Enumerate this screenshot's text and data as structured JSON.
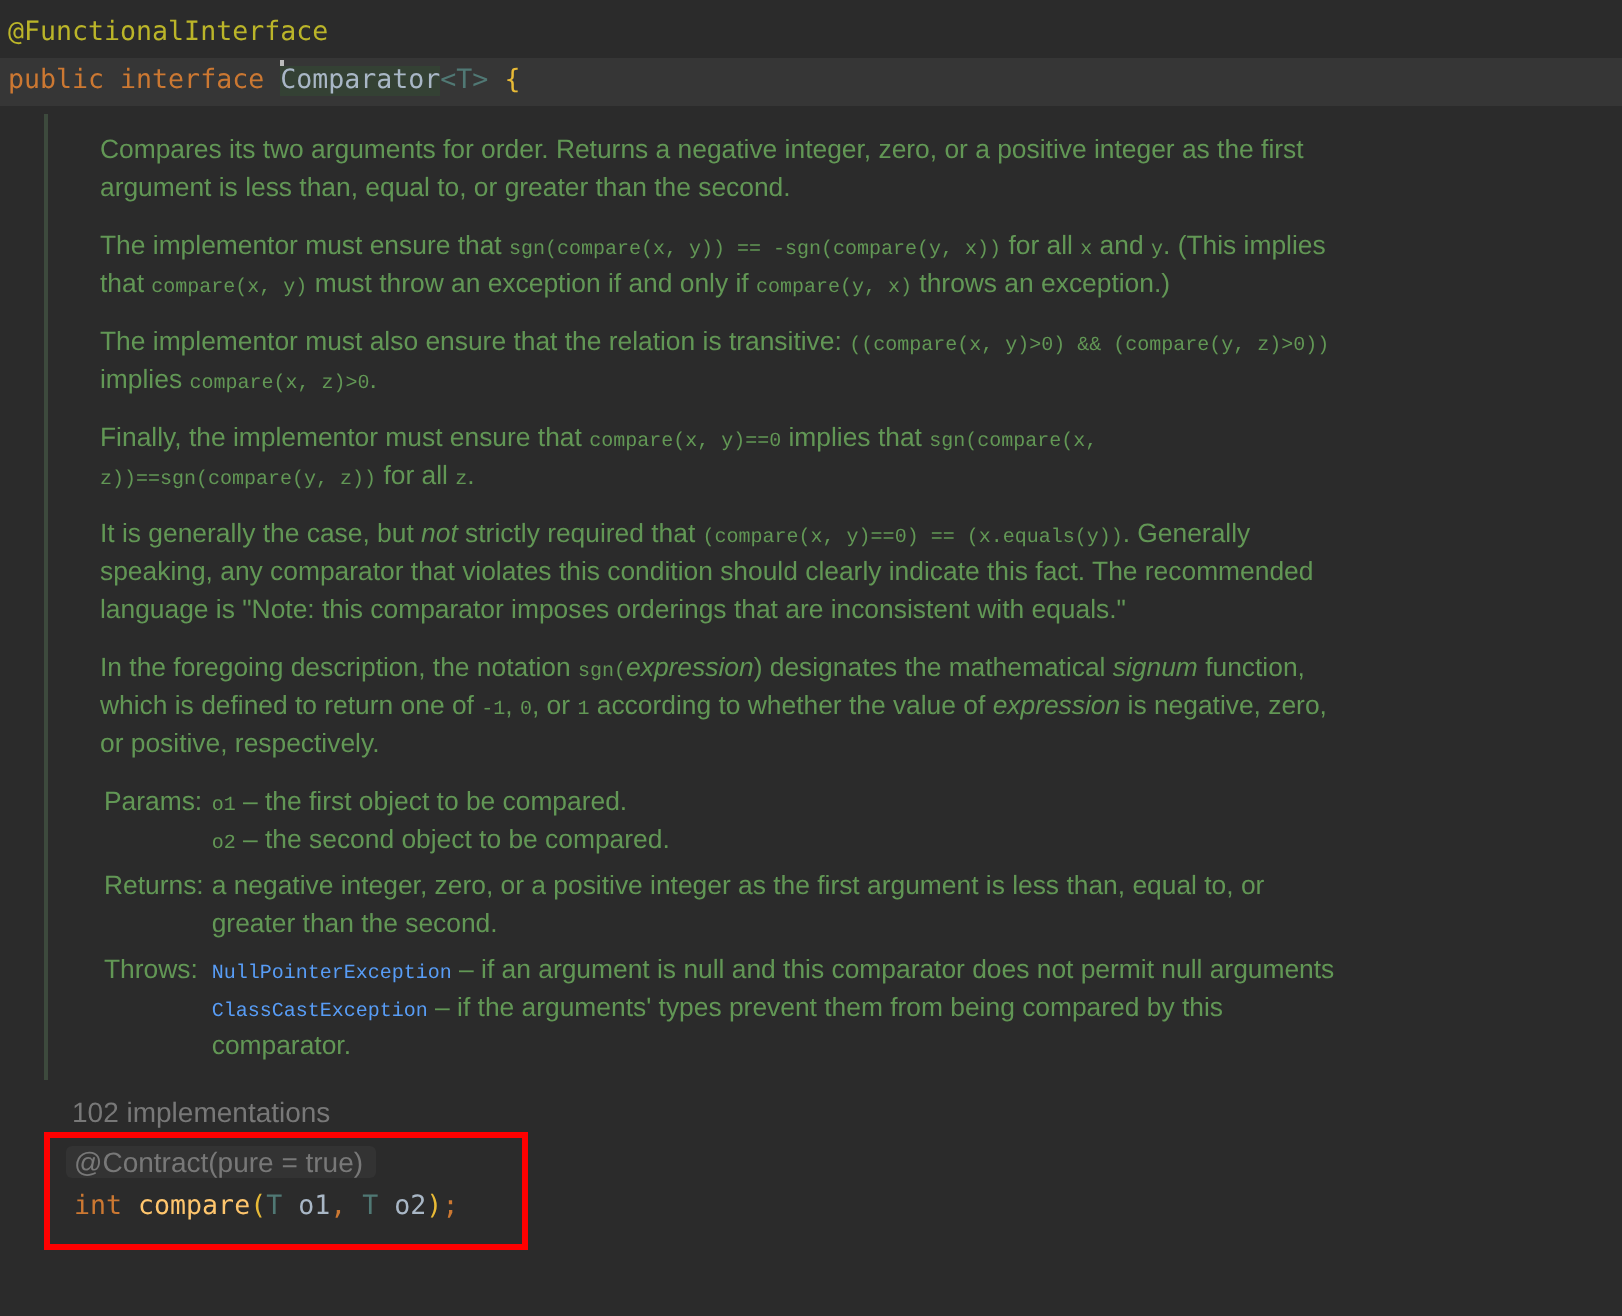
{
  "code_top": [
    {
      "tokens": [
        {
          "kind": "annotation",
          "text": "@FunctionalInterface"
        }
      ]
    },
    {
      "current": true,
      "tokens": [
        {
          "kind": "keyword",
          "text": "public interface "
        },
        {
          "kind": "class",
          "text": "Comparator"
        },
        {
          "kind": "typeparam",
          "text": "<T>"
        },
        {
          "kind": "brace",
          "text": " {"
        }
      ]
    }
  ],
  "doc": {
    "paragraphs": [
      [
        {
          "kind": "text",
          "text": "Compares its two arguments for order. Returns a negative integer, zero, or a positive integer as the first argument is less than, equal to, or greater than the second."
        }
      ],
      [
        {
          "kind": "text",
          "text": "The implementor must ensure that "
        },
        {
          "kind": "code",
          "text": "sgn(compare(x, y)) == -sgn(compare(y, x))"
        },
        {
          "kind": "text",
          "text": " for all "
        },
        {
          "kind": "code",
          "text": "x"
        },
        {
          "kind": "text",
          "text": " and "
        },
        {
          "kind": "code",
          "text": "y"
        },
        {
          "kind": "text",
          "text": ". (This implies that "
        },
        {
          "kind": "code",
          "text": "compare(x, y)"
        },
        {
          "kind": "text",
          "text": " must throw an exception if and only if "
        },
        {
          "kind": "code",
          "text": "compare(y, x)"
        },
        {
          "kind": "text",
          "text": " throws an exception.)"
        }
      ],
      [
        {
          "kind": "text",
          "text": "The implementor must also ensure that the relation is transitive: "
        },
        {
          "kind": "code",
          "text": "((compare(x, y)>0) && (compare(y, z)>0))"
        },
        {
          "kind": "text",
          "text": " implies "
        },
        {
          "kind": "code",
          "text": "compare(x, z)>0"
        },
        {
          "kind": "text",
          "text": "."
        }
      ],
      [
        {
          "kind": "text",
          "text": "Finally, the implementor must ensure that "
        },
        {
          "kind": "code",
          "text": "compare(x, y)==0"
        },
        {
          "kind": "text",
          "text": " implies that "
        },
        {
          "kind": "code",
          "text": "sgn(compare(x, z))==sgn(compare(y, z))"
        },
        {
          "kind": "text",
          "text": " for all "
        },
        {
          "kind": "code",
          "text": "z"
        },
        {
          "kind": "text",
          "text": "."
        }
      ],
      [
        {
          "kind": "text",
          "text": "It is generally the case, but "
        },
        {
          "kind": "em",
          "text": "not"
        },
        {
          "kind": "text",
          "text": " strictly required that "
        },
        {
          "kind": "code",
          "text": "(compare(x, y)==0) == (x.equals(y))"
        },
        {
          "kind": "text",
          "text": ". Generally speaking, any comparator that violates this condition should clearly indicate this fact. The recommended language is \"Note: this comparator imposes orderings that are inconsistent with equals.\""
        }
      ],
      [
        {
          "kind": "text",
          "text": "In the foregoing description, the notation "
        },
        {
          "kind": "code",
          "text": "sgn("
        },
        {
          "kind": "em",
          "text": "expression"
        },
        {
          "kind": "text",
          "text": ") designates the mathematical "
        },
        {
          "kind": "em",
          "text": "signum"
        },
        {
          "kind": "text",
          "text": " function, which is defined to return one of "
        },
        {
          "kind": "code",
          "text": "-1"
        },
        {
          "kind": "text",
          "text": ", "
        },
        {
          "kind": "code",
          "text": "0"
        },
        {
          "kind": "text",
          "text": ", or "
        },
        {
          "kind": "code",
          "text": "1"
        },
        {
          "kind": "text",
          "text": " according to whether the value of "
        },
        {
          "kind": "em",
          "text": "expression"
        },
        {
          "kind": "text",
          "text": " is negative, zero, or positive, respectively."
        }
      ]
    ],
    "sections": [
      {
        "label": "Params:",
        "entries": [
          [
            {
              "kind": "code",
              "text": "o1"
            },
            {
              "kind": "text",
              "text": " – the first object to be compared."
            }
          ],
          [
            {
              "kind": "code",
              "text": "o2"
            },
            {
              "kind": "text",
              "text": " – the second object to be compared."
            }
          ]
        ]
      },
      {
        "label": "Returns:",
        "entries": [
          [
            {
              "kind": "text",
              "text": "a negative integer, zero, or a positive integer as the first argument is less than, equal to, or greater than the second."
            }
          ]
        ]
      },
      {
        "label": "Throws:",
        "entries": [
          [
            {
              "kind": "link",
              "text": "NullPointerException"
            },
            {
              "kind": "text",
              "text": " – if an argument is null and this comparator does not permit null arguments"
            }
          ],
          [
            {
              "kind": "link",
              "text": "ClassCastException"
            },
            {
              "kind": "text",
              "text": " – if the arguments' types prevent them from being compared by this comparator."
            }
          ]
        ]
      }
    ]
  },
  "implementations": "102 implementations",
  "highlighted": {
    "annotation": "@Contract(pure = true)",
    "tokens": [
      {
        "kind": "keyword",
        "text": "int "
      },
      {
        "kind": "method",
        "text": "compare"
      },
      {
        "kind": "paren",
        "text": "("
      },
      {
        "kind": "typeparam",
        "text": "T "
      },
      {
        "kind": "param",
        "text": "o1"
      },
      {
        "kind": "plain",
        "text": ", "
      },
      {
        "kind": "typeparam",
        "text": "T "
      },
      {
        "kind": "param",
        "text": "o2"
      },
      {
        "kind": "paren",
        "text": ")"
      },
      {
        "kind": "plain",
        "text": ";"
      }
    ]
  }
}
